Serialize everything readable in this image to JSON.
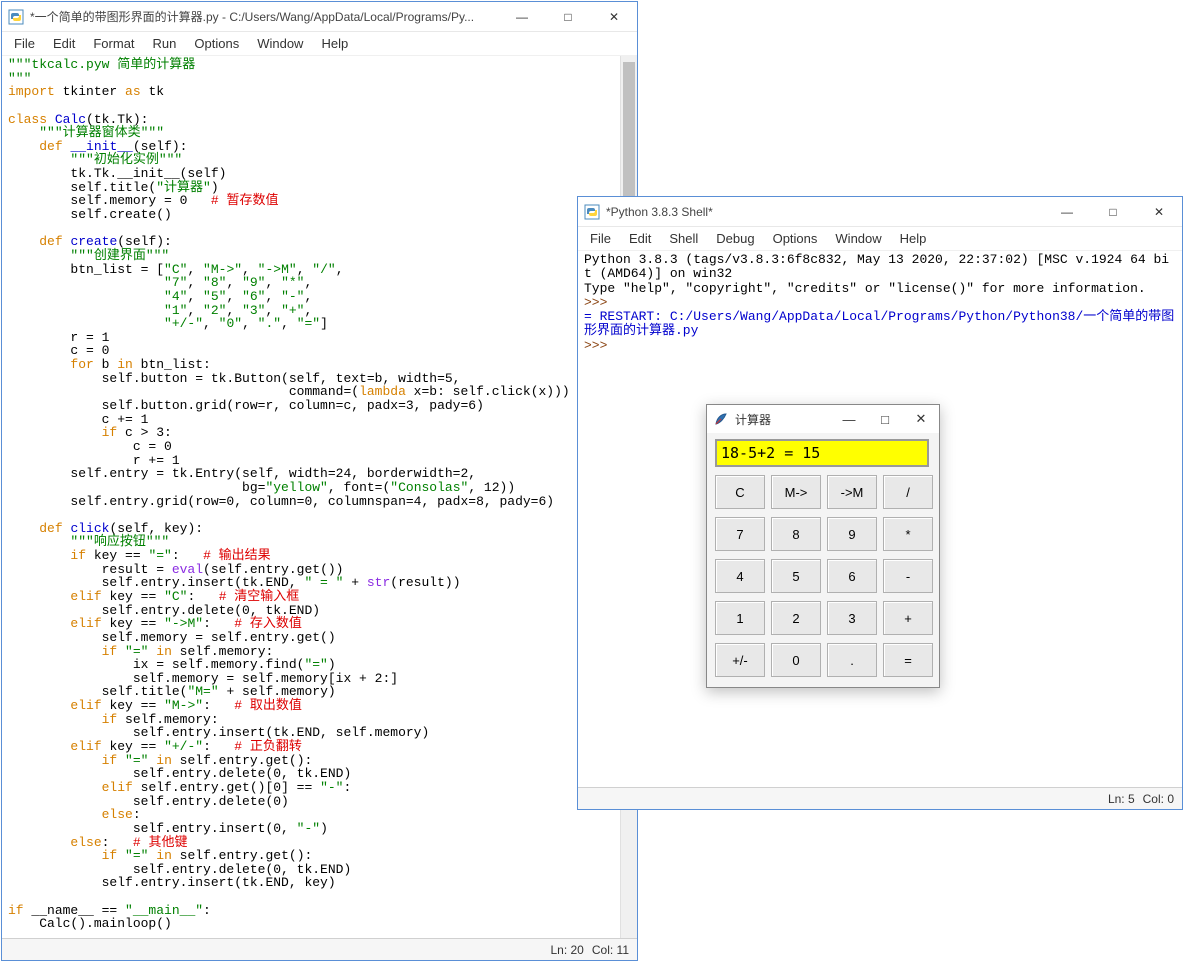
{
  "editor_window": {
    "title": "*一个简单的带图形界面的计算器.py - C:/Users/Wang/AppData/Local/Programs/Py...",
    "menu": [
      "File",
      "Edit",
      "Format",
      "Run",
      "Options",
      "Window",
      "Help"
    ],
    "status_ln": "Ln: 20",
    "status_col": "Col: 11",
    "code_tokens": [
      [
        [
          "str",
          "\"\"\"tkcalc.pyw 简单的计算器"
        ]
      ],
      [
        [
          "str",
          "\"\"\""
        ]
      ],
      [
        [
          "kw",
          "import"
        ],
        [
          "",
          " tkinter "
        ],
        [
          "kw",
          "as"
        ],
        [
          "",
          " tk"
        ]
      ],
      [
        [
          "",
          ""
        ]
      ],
      [
        [
          "kw",
          "class"
        ],
        [
          "",
          " "
        ],
        [
          "def",
          "Calc"
        ],
        [
          "",
          "(tk.Tk):"
        ]
      ],
      [
        [
          "",
          "    "
        ],
        [
          "str",
          "\"\"\"计算器窗体类\"\"\""
        ]
      ],
      [
        [
          "",
          "    "
        ],
        [
          "kw",
          "def"
        ],
        [
          "",
          " "
        ],
        [
          "def",
          "__init__"
        ],
        [
          "",
          "(self):"
        ]
      ],
      [
        [
          "",
          "        "
        ],
        [
          "str",
          "\"\"\"初始化实例\"\"\""
        ]
      ],
      [
        [
          "",
          "        tk.Tk.__init__(self)"
        ]
      ],
      [
        [
          "",
          "        self.title("
        ],
        [
          "str",
          "\"计算器\""
        ],
        [
          "",
          ")"
        ]
      ],
      [
        [
          "",
          "        self.memory = 0   "
        ],
        [
          "cmt",
          "# 暂存数值"
        ]
      ],
      [
        [
          "",
          "        self.create()"
        ]
      ],
      [
        [
          "",
          ""
        ]
      ],
      [
        [
          "",
          "    "
        ],
        [
          "kw",
          "def"
        ],
        [
          "",
          " "
        ],
        [
          "def",
          "create"
        ],
        [
          "",
          "(self):"
        ]
      ],
      [
        [
          "",
          "        "
        ],
        [
          "str",
          "\"\"\"创建界面\"\"\""
        ]
      ],
      [
        [
          "",
          "        btn_list = ["
        ],
        [
          "str",
          "\"C\""
        ],
        [
          "",
          ", "
        ],
        [
          "str",
          "\"M->\""
        ],
        [
          "",
          ", "
        ],
        [
          "str",
          "\"->M\""
        ],
        [
          "",
          ", "
        ],
        [
          "str",
          "\"/\""
        ],
        [
          "",
          ","
        ]
      ],
      [
        [
          "",
          "                    "
        ],
        [
          "str",
          "\"7\""
        ],
        [
          "",
          ", "
        ],
        [
          "str",
          "\"8\""
        ],
        [
          "",
          ", "
        ],
        [
          "str",
          "\"9\""
        ],
        [
          "",
          ", "
        ],
        [
          "str",
          "\"*\""
        ],
        [
          "",
          ","
        ]
      ],
      [
        [
          "",
          "                    "
        ],
        [
          "str",
          "\"4\""
        ],
        [
          "",
          ", "
        ],
        [
          "str",
          "\"5\""
        ],
        [
          "",
          ", "
        ],
        [
          "str",
          "\"6\""
        ],
        [
          "",
          ", "
        ],
        [
          "str",
          "\"-\""
        ],
        [
          "",
          ","
        ]
      ],
      [
        [
          "",
          "                    "
        ],
        [
          "str",
          "\"1\""
        ],
        [
          "",
          ", "
        ],
        [
          "str",
          "\"2\""
        ],
        [
          "",
          ", "
        ],
        [
          "str",
          "\"3\""
        ],
        [
          "",
          ", "
        ],
        [
          "str",
          "\"+\""
        ],
        [
          "",
          ","
        ]
      ],
      [
        [
          "",
          "                    "
        ],
        [
          "str",
          "\"+/-\""
        ],
        [
          "",
          ", "
        ],
        [
          "str",
          "\"0\""
        ],
        [
          "",
          ", "
        ],
        [
          "str",
          "\".\""
        ],
        [
          "",
          ", "
        ],
        [
          "str",
          "\"=\""
        ],
        [
          "",
          "]"
        ]
      ],
      [
        [
          "",
          "        r = 1"
        ]
      ],
      [
        [
          "",
          "        c = 0"
        ]
      ],
      [
        [
          "",
          "        "
        ],
        [
          "kw",
          "for"
        ],
        [
          "",
          " b "
        ],
        [
          "kw",
          "in"
        ],
        [
          "",
          " btn_list:"
        ]
      ],
      [
        [
          "",
          "            self.button = tk.Button(self, text=b, width=5,"
        ]
      ],
      [
        [
          "",
          "                                    command=("
        ],
        [
          "kw",
          "lambda"
        ],
        [
          "",
          " x=b: self.click(x)))"
        ]
      ],
      [
        [
          "",
          "            self.button.grid(row=r, column=c, padx=3, pady=6)"
        ]
      ],
      [
        [
          "",
          "            c += 1"
        ]
      ],
      [
        [
          "",
          "            "
        ],
        [
          "kw",
          "if"
        ],
        [
          "",
          " c > 3:"
        ]
      ],
      [
        [
          "",
          "                c = 0"
        ]
      ],
      [
        [
          "",
          "                r += 1"
        ]
      ],
      [
        [
          "",
          "        self.entry = tk.Entry(self, width=24, borderwidth=2,"
        ]
      ],
      [
        [
          "",
          "                              bg="
        ],
        [
          "str",
          "\"yellow\""
        ],
        [
          "",
          ", font=("
        ],
        [
          "str",
          "\"Consolas\""
        ],
        [
          "",
          ", 12))"
        ]
      ],
      [
        [
          "",
          "        self.entry.grid(row=0, column=0, columnspan=4, padx=8, pady=6)"
        ]
      ],
      [
        [
          "",
          ""
        ]
      ],
      [
        [
          "",
          "    "
        ],
        [
          "kw",
          "def"
        ],
        [
          "",
          " "
        ],
        [
          "def",
          "click"
        ],
        [
          "",
          "(self, key):"
        ]
      ],
      [
        [
          "",
          "        "
        ],
        [
          "str",
          "\"\"\"响应按钮\"\"\""
        ]
      ],
      [
        [
          "",
          "        "
        ],
        [
          "kw",
          "if"
        ],
        [
          "",
          " key == "
        ],
        [
          "str",
          "\"=\""
        ],
        [
          "",
          ":   "
        ],
        [
          "cmt",
          "# 输出结果"
        ]
      ],
      [
        [
          "",
          "            result = "
        ],
        [
          "bi",
          "eval"
        ],
        [
          "",
          "(self.entry.get())"
        ]
      ],
      [
        [
          "",
          "            self.entry.insert(tk.END, "
        ],
        [
          "str",
          "\" = \""
        ],
        [
          "",
          " + "
        ],
        [
          "bi",
          "str"
        ],
        [
          "",
          "(result))"
        ]
      ],
      [
        [
          "",
          "        "
        ],
        [
          "kw",
          "elif"
        ],
        [
          "",
          " key == "
        ],
        [
          "str",
          "\"C\""
        ],
        [
          "",
          ":   "
        ],
        [
          "cmt",
          "# 清空输入框"
        ]
      ],
      [
        [
          "",
          "            self.entry.delete(0, tk.END)"
        ]
      ],
      [
        [
          "",
          "        "
        ],
        [
          "kw",
          "elif"
        ],
        [
          "",
          " key == "
        ],
        [
          "str",
          "\"->M\""
        ],
        [
          "",
          ":   "
        ],
        [
          "cmt",
          "# 存入数值"
        ]
      ],
      [
        [
          "",
          "            self.memory = self.entry.get()"
        ]
      ],
      [
        [
          "",
          "            "
        ],
        [
          "kw",
          "if"
        ],
        [
          "",
          " "
        ],
        [
          "str",
          "\"=\""
        ],
        [
          "",
          " "
        ],
        [
          "kw",
          "in"
        ],
        [
          "",
          " self.memory:"
        ]
      ],
      [
        [
          "",
          "                ix = self.memory.find("
        ],
        [
          "str",
          "\"=\""
        ],
        [
          "",
          ")"
        ]
      ],
      [
        [
          "",
          "                self.memory = self.memory[ix + 2:]"
        ]
      ],
      [
        [
          "",
          "            self.title("
        ],
        [
          "str",
          "\"M=\""
        ],
        [
          "",
          " + self.memory)"
        ]
      ],
      [
        [
          "",
          "        "
        ],
        [
          "kw",
          "elif"
        ],
        [
          "",
          " key == "
        ],
        [
          "str",
          "\"M->\""
        ],
        [
          "",
          ":   "
        ],
        [
          "cmt",
          "# 取出数值"
        ]
      ],
      [
        [
          "",
          "            "
        ],
        [
          "kw",
          "if"
        ],
        [
          "",
          " self.memory:"
        ]
      ],
      [
        [
          "",
          "                self.entry.insert(tk.END, self.memory)"
        ]
      ],
      [
        [
          "",
          "        "
        ],
        [
          "kw",
          "elif"
        ],
        [
          "",
          " key == "
        ],
        [
          "str",
          "\"+/-\""
        ],
        [
          "",
          ":   "
        ],
        [
          "cmt",
          "# 正负翻转"
        ]
      ],
      [
        [
          "",
          "            "
        ],
        [
          "kw",
          "if"
        ],
        [
          "",
          " "
        ],
        [
          "str",
          "\"=\""
        ],
        [
          "",
          " "
        ],
        [
          "kw",
          "in"
        ],
        [
          "",
          " self.entry.get():"
        ]
      ],
      [
        [
          "",
          "                self.entry.delete(0, tk.END)"
        ]
      ],
      [
        [
          "",
          "            "
        ],
        [
          "kw",
          "elif"
        ],
        [
          "",
          " self.entry.get()[0] == "
        ],
        [
          "str",
          "\"-\""
        ],
        [
          "",
          ":"
        ]
      ],
      [
        [
          "",
          "                self.entry.delete(0)"
        ]
      ],
      [
        [
          "",
          "            "
        ],
        [
          "kw",
          "else"
        ],
        [
          "",
          ":"
        ]
      ],
      [
        [
          "",
          "                self.entry.insert(0, "
        ],
        [
          "str",
          "\"-\""
        ],
        [
          "",
          ")"
        ]
      ],
      [
        [
          "",
          "        "
        ],
        [
          "kw",
          "else"
        ],
        [
          "",
          ":   "
        ],
        [
          "cmt",
          "# 其他键"
        ]
      ],
      [
        [
          "",
          "            "
        ],
        [
          "kw",
          "if"
        ],
        [
          "",
          " "
        ],
        [
          "str",
          "\"=\""
        ],
        [
          "",
          " "
        ],
        [
          "kw",
          "in"
        ],
        [
          "",
          " self.entry.get():"
        ]
      ],
      [
        [
          "",
          "                self.entry.delete(0, tk.END)"
        ]
      ],
      [
        [
          "",
          "            self.entry.insert(tk.END, key)"
        ]
      ],
      [
        [
          "",
          ""
        ]
      ],
      [
        [
          "kw",
          "if"
        ],
        [
          "",
          " __name__ == "
        ],
        [
          "str",
          "\"__main__\""
        ],
        [
          "",
          ":"
        ]
      ],
      [
        [
          "",
          "    Calc().mainloop()"
        ]
      ]
    ]
  },
  "shell_window": {
    "title": "*Python 3.8.3 Shell*",
    "menu": [
      "File",
      "Edit",
      "Shell",
      "Debug",
      "Options",
      "Window",
      "Help"
    ],
    "status_ln": "Ln: 5",
    "status_col": "Col: 0",
    "banner1": "Python 3.8.3 (tags/v3.8.3:6f8c832, May 13 2020, 22:37:02) [MSC v.1924 64 bit (AMD64)] on win32",
    "banner2": "Type \"help\", \"copyright\", \"credits\" or \"license()\" for more information.",
    "prompt": ">>>",
    "restart": "= RESTART: C:/Users/Wang/AppData/Local/Programs/Python/Python38/一个简单的带图形界面的计算器.py"
  },
  "calc_window": {
    "title": "计算器",
    "entry_value": "18-5+2 = 15",
    "buttons": [
      "C",
      "M->",
      "->M",
      "/",
      "7",
      "8",
      "9",
      "*",
      "4",
      "5",
      "6",
      "-",
      "1",
      "2",
      "3",
      "+",
      "+/-",
      "0",
      ".",
      "="
    ]
  },
  "win_ctrl": {
    "min": "—",
    "max": "□",
    "close": "✕"
  }
}
